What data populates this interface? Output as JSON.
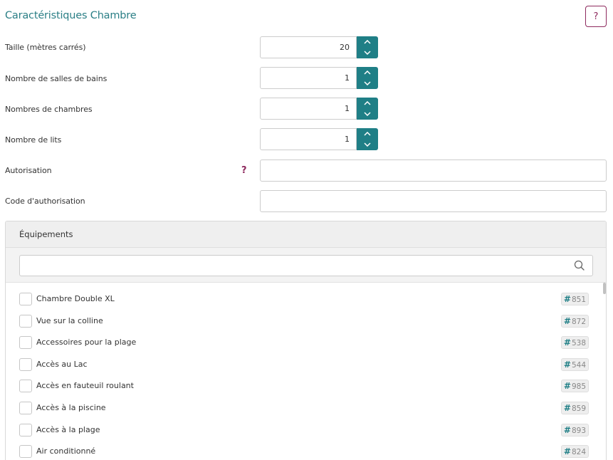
{
  "section": {
    "title": "Caractéristiques Chambre",
    "help_button": "?"
  },
  "fields": {
    "size": {
      "label": "Taille (mètres carrés)",
      "value": "20"
    },
    "bathrooms": {
      "label": "Nombre de salles de bains",
      "value": "1"
    },
    "bedrooms": {
      "label": "Nombres de chambres",
      "value": "1"
    },
    "beds": {
      "label": "Nombre de lits",
      "value": "1"
    },
    "authorization": {
      "label": "Autorisation",
      "help": "?",
      "value": ""
    },
    "authorization_code": {
      "label": "Code d'authorisation",
      "value": ""
    }
  },
  "amenities": {
    "title": "Équipements",
    "search": {
      "value": "",
      "placeholder": ""
    },
    "items": [
      {
        "label": "Chambre Double XL",
        "id": "851"
      },
      {
        "label": "Vue sur la colline",
        "id": "872"
      },
      {
        "label": "Accessoires pour la plage",
        "id": "538"
      },
      {
        "label": "Accès au Lac",
        "id": "544"
      },
      {
        "label": "Accès en fauteuil roulant",
        "id": "985"
      },
      {
        "label": "Accès à la piscine",
        "id": "859"
      },
      {
        "label": "Accès à la plage",
        "id": "893"
      },
      {
        "label": "Air conditionné",
        "id": "824"
      }
    ]
  },
  "icons": {
    "help": "question-icon",
    "spin_up": "chevron-up-icon",
    "spin_down": "chevron-down-icon",
    "search": "search-icon",
    "badge": "hash-icon"
  },
  "colors": {
    "accent": "#1f7f86",
    "title": "#2b7f86",
    "help": "#8e2a5e"
  }
}
